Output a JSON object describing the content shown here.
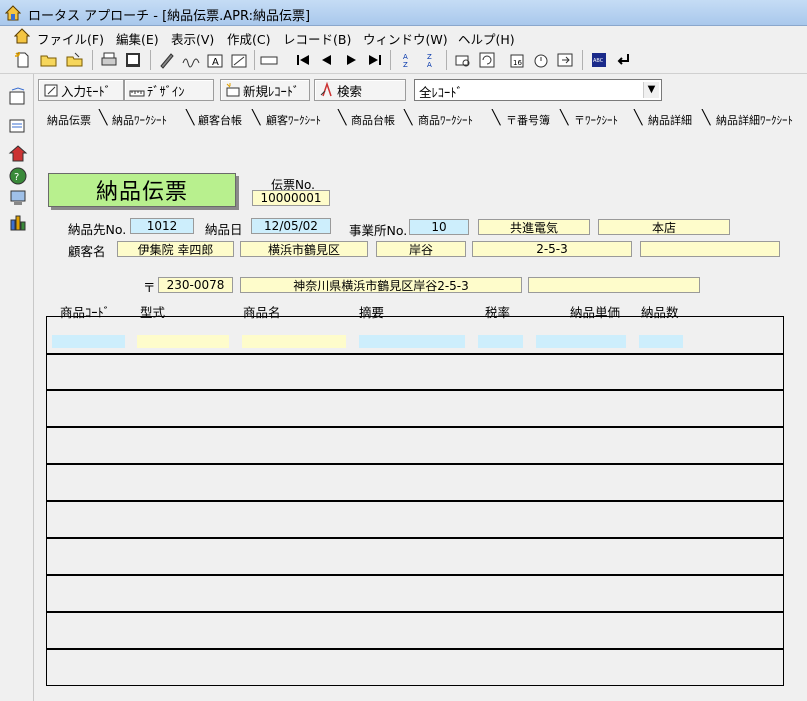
{
  "window": {
    "title": "ロータス アプローチ - [納品伝票.APR:納品伝票]"
  },
  "menu": [
    "ファイル(F)",
    "編集(E)",
    "表示(V)",
    "作成(C)",
    "レコード(B)",
    "ウィンドウ(W)",
    "ヘルプ(H)"
  ],
  "toolbar2": {
    "input_mode": "入力ﾓｰﾄﾞ",
    "design": "ﾃﾞｻﾞｲﾝ",
    "new_record": "新規ﾚｺｰﾄﾞ",
    "search": "検索",
    "view_select": "全ﾚｺｰﾄﾞ"
  },
  "tabs": [
    "納品伝票",
    "納品ﾜｰｸｼｰﾄ",
    "顧客台帳",
    "顧客ﾜｰｸｼｰﾄ",
    "商品台帳",
    "商品ﾜｰｸｼｰﾄ",
    "〒番号簿",
    "〒ﾜｰｸｼｰﾄ",
    "納品詳細",
    "納品詳細ﾜｰｸｼｰﾄ"
  ],
  "form": {
    "title": "納品伝票",
    "slip_no_label": "伝票No.",
    "slip_no": "10000001",
    "customer_no_label": "納品先No.",
    "customer_no": "1012",
    "delivery_date_label": "納品日",
    "delivery_date": "12/05/02",
    "office_no_label": "事業所No.",
    "office_no": "10",
    "company": "共進電気",
    "branch": "本店",
    "customer_name_label": "顧客名",
    "customer_name": "伊集院 幸四郎",
    "city": "横浜市鶴見区",
    "town": "岸谷",
    "block": "2-5-3",
    "postal_mark": "〒",
    "postal_code": "230-0078",
    "full_address": "神奈川県横浜市鶴見区岸谷2-5-3"
  },
  "detail": {
    "columns": [
      "商品ｺｰﾄﾞ",
      "型式",
      "商品名",
      "摘要",
      "税率",
      "納品単価",
      "納品数"
    ]
  },
  "colors": {
    "title_bg": "#b8f08e",
    "field_blue": "#cdeefc",
    "field_yellow": "#fefccb"
  }
}
